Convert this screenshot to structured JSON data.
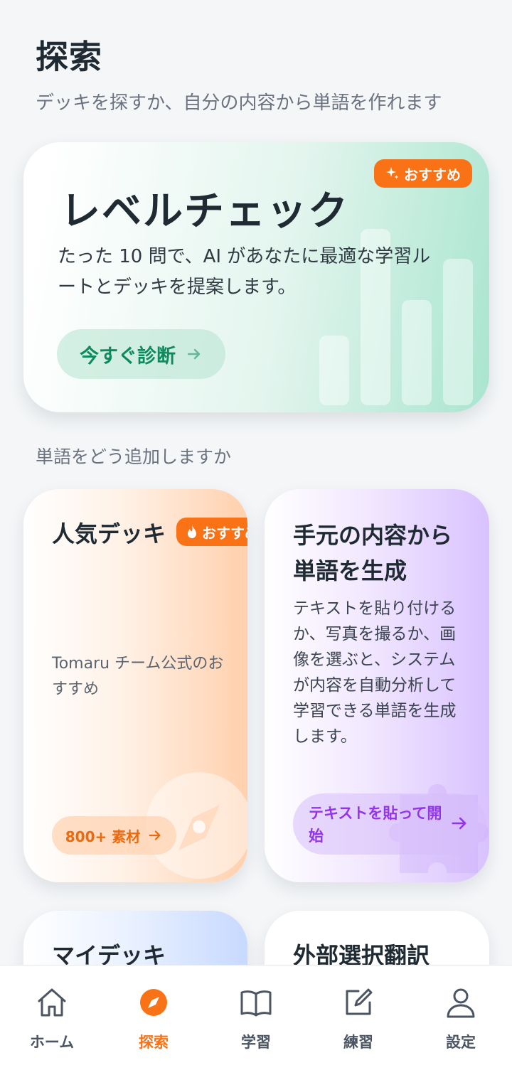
{
  "header": {
    "title": "探索",
    "subtitle": "デッキを探すか、自分の内容から単語を作れます"
  },
  "hero": {
    "badge": "おすすめ",
    "title": "レベルチェック",
    "description": "たった 10 問で、AI があなたに最適な学習ルートとデッキを提案します。",
    "button": "今すぐ診断"
  },
  "section": {
    "title": "単語をどう追加しますか"
  },
  "cards": {
    "popular": {
      "title": "人気デッキ",
      "badge": "おすすめ",
      "description": "Tomaru チーム公式のおすすめ",
      "button": "800+ 素材"
    },
    "generate": {
      "title": "手元の内容から単語を生成",
      "description": "テキストを貼り付けるか、写真を撮るか、画像を選ぶと、システムが内容を自動分析して学習できる単語を生成します。",
      "button": "テキストを貼って開始"
    },
    "my_deck": {
      "title": "マイデッキ"
    },
    "external": {
      "title": "外部選択翻訳"
    }
  },
  "tabbar": {
    "items": [
      {
        "label": "ホーム",
        "icon": "home-icon"
      },
      {
        "label": "探索",
        "icon": "compass-icon",
        "active": true
      },
      {
        "label": "学習",
        "icon": "book-icon"
      },
      {
        "label": "練習",
        "icon": "edit-icon"
      },
      {
        "label": "設定",
        "icon": "user-icon"
      }
    ]
  },
  "colors": {
    "accent": "#f97316",
    "hero_button_text": "#0f8a5f",
    "generate_accent": "#9333ea",
    "background": "#f4f6f8"
  }
}
